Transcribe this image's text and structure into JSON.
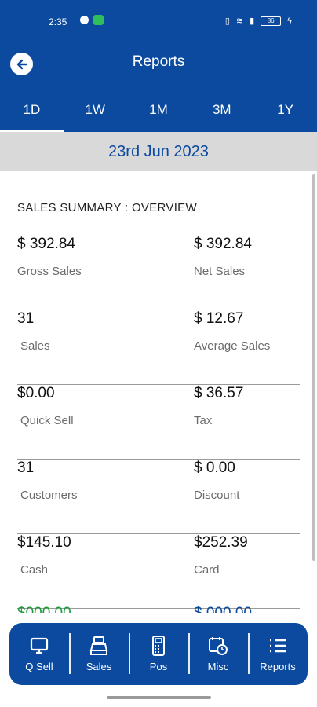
{
  "status_bar": {
    "time": "2:35",
    "battery": "86"
  },
  "header": {
    "title": "Reports"
  },
  "tabs": [
    {
      "label": "1D",
      "active": true
    },
    {
      "label": "1W",
      "active": false
    },
    {
      "label": "1M",
      "active": false
    },
    {
      "label": "3M",
      "active": false
    },
    {
      "label": "1Y",
      "active": false
    }
  ],
  "date": "23rd Jun 2023",
  "summary": {
    "title": "SALES SUMMARY : OVERVIEW",
    "rows": [
      {
        "left": {
          "value": "$ 392.84",
          "label": "Gross Sales"
        },
        "right": {
          "value": "$ 392.84",
          "label": "Net Sales"
        }
      },
      {
        "left": {
          "value": "31",
          "label": "Sales"
        },
        "right": {
          "value": "$ 12.67",
          "label": "Average Sales"
        }
      },
      {
        "left": {
          "value": "$0.00",
          "label": "Quick Sell"
        },
        "right": {
          "value": "$ 36.57",
          "label": "Tax"
        }
      },
      {
        "left": {
          "value": "31",
          "label": "Customers"
        },
        "right": {
          "value": "$ 0.00",
          "label": "Discount"
        }
      },
      {
        "left": {
          "value": "$145.10",
          "label": "Cash"
        },
        "right": {
          "value": "$252.39",
          "label": "Card"
        }
      }
    ]
  },
  "bottom_nav": [
    {
      "label": "Q Sell",
      "icon": "monitor-icon"
    },
    {
      "label": "Sales",
      "icon": "cash-register-icon"
    },
    {
      "label": "Pos",
      "icon": "pos-terminal-icon"
    },
    {
      "label": "Misc",
      "icon": "calendar-clock-icon"
    },
    {
      "label": "Reports",
      "icon": "list-icon"
    }
  ],
  "colors": {
    "primary": "#0b4a9e",
    "date_bar": "#d9d9d9",
    "positive": "#1c9a3a"
  }
}
